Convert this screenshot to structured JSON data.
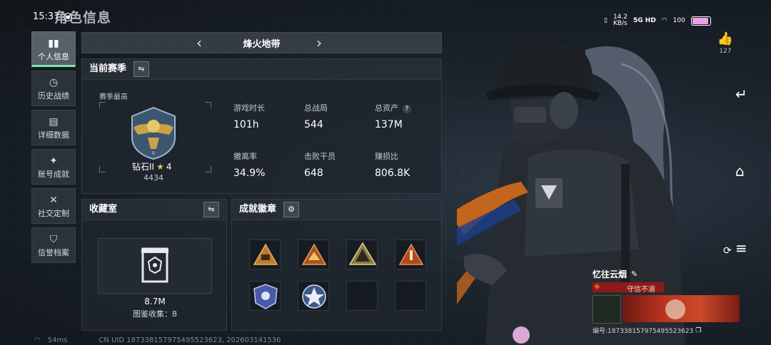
{
  "status_bar": {
    "time": "15:37",
    "network_speed": "14.2\nKB/s",
    "network_type": "5G HD",
    "battery": "100",
    "battery_level": 1.0
  },
  "page_title": "角色信息",
  "nav": [
    {
      "label": "个人信息",
      "icon": "bar-chart-icon",
      "active": true
    },
    {
      "label": "历史战绩",
      "icon": "clock-icon",
      "active": false
    },
    {
      "label": "详细数据",
      "icon": "folder-icon",
      "active": false
    },
    {
      "label": "账号成就",
      "icon": "star-badge-icon",
      "active": false
    },
    {
      "label": "社交定制",
      "icon": "tools-icon",
      "active": false
    },
    {
      "label": "信誉档案",
      "icon": "shield-icon",
      "active": false
    }
  ],
  "season_selector": {
    "title": "烽火地带"
  },
  "current_season": {
    "title": "当前赛季",
    "season_best_label": "赛季最高",
    "rank_name": "钻石II",
    "rank_stars": "4",
    "rank_points": "4434",
    "stats": [
      {
        "label": "游戏时长",
        "value": "101h"
      },
      {
        "label": "总战局",
        "value": "544"
      },
      {
        "label": "总资产",
        "value": "137M",
        "help": "?"
      },
      {
        "label": "撤离率",
        "value": "34.9%"
      },
      {
        "label": "击败干员",
        "value": "648"
      },
      {
        "label": "赚损比",
        "value": "806.8K"
      }
    ]
  },
  "collection": {
    "title": "收藏室",
    "value": "8.7M",
    "catalog_label": "图鉴收集：8"
  },
  "achievements": {
    "title": "成就徽章",
    "slots": 8,
    "filled": 6
  },
  "likes": {
    "count": "127"
  },
  "player_card": {
    "name": "忆往云烟",
    "motto": "守信不渝",
    "id_label": "编号:187338157975495523623"
  },
  "footer": {
    "ping": "54ms",
    "uid": "CN UID 187338157975495523623, 202603141536"
  },
  "colors": {
    "accent_green": "#7fe0b0",
    "orange": "#e07a1f",
    "red": "#8b1a1a"
  }
}
